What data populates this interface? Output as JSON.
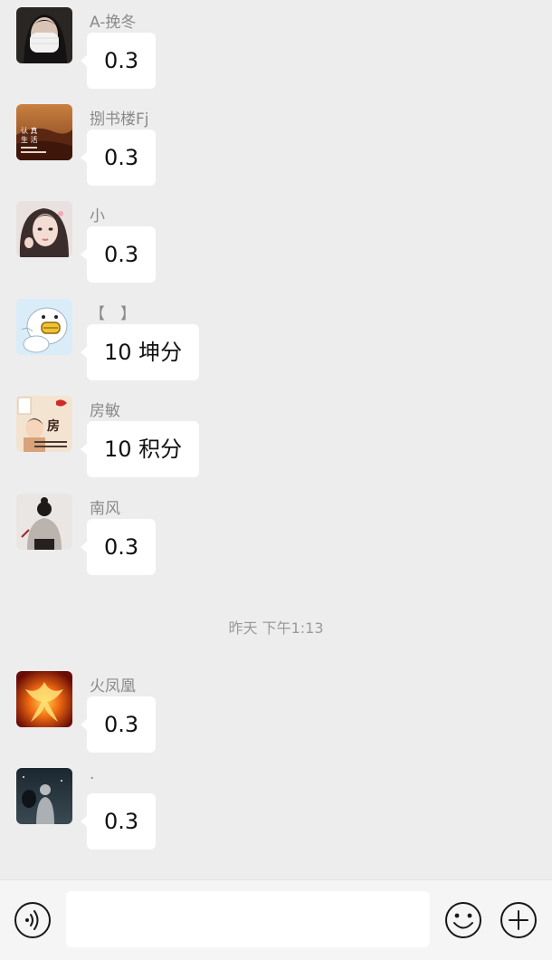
{
  "messages": [
    {
      "sender": "A-挽冬",
      "text": "0.3",
      "avatar": "masked-person-photo"
    },
    {
      "sender": "捌书楼Fj",
      "text": "0.3",
      "avatar": "desert-dunes-photo"
    },
    {
      "sender": "小",
      "text": "0.3",
      "avatar": "girl-portrait-photo"
    },
    {
      "sender": "【　】",
      "text": "10 坤分",
      "avatar": "cartoon-duck"
    },
    {
      "sender": "房敏",
      "text": "10 积分",
      "avatar": "cartoon-boy-fang"
    },
    {
      "sender": "南风",
      "text": "0.3",
      "avatar": "girl-back-illustration"
    },
    {
      "sender": "火凤凰",
      "text": "0.3",
      "avatar": "fire-phoenix"
    },
    {
      "sender": "·",
      "text": "0.3",
      "avatar": "man-night-photo"
    }
  ],
  "time_divider": "昨天 下午1:13",
  "input_bar": {
    "voice_icon": "voice-icon",
    "emoji_icon": "emoji-icon",
    "plus_icon": "plus-icon",
    "text_value": ""
  }
}
